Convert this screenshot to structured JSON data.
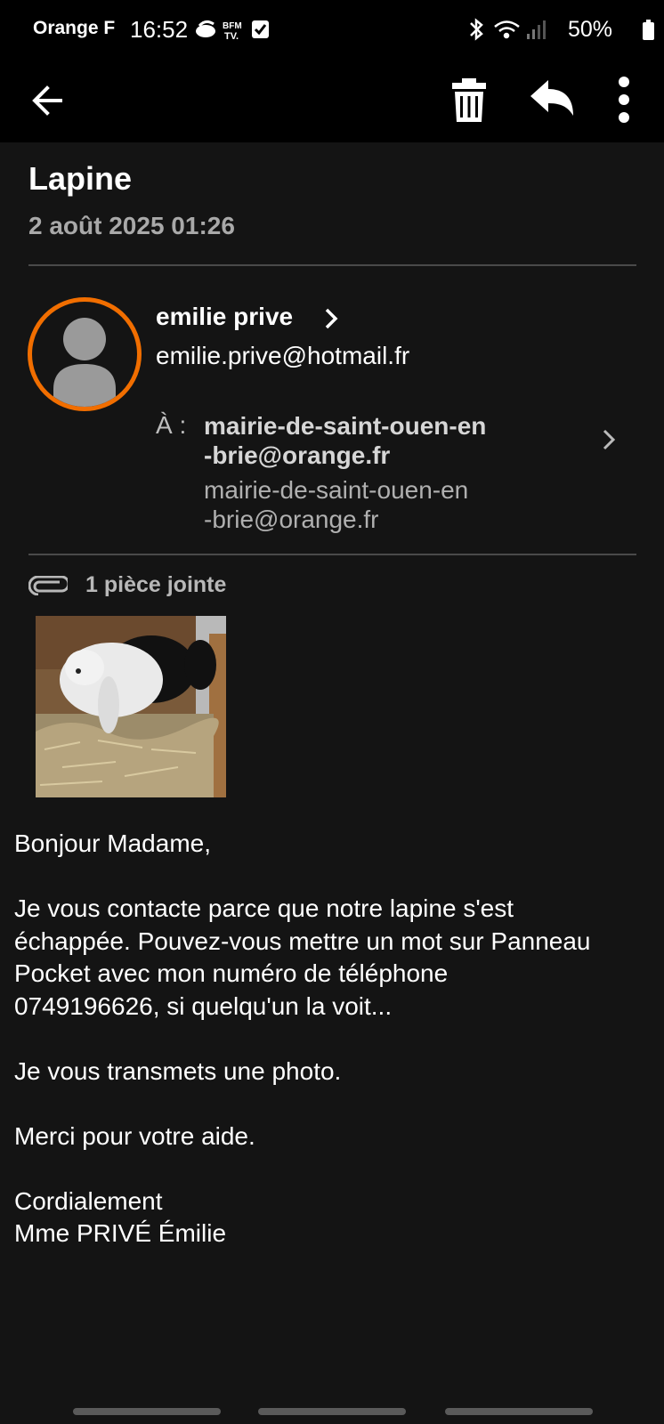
{
  "status_bar": {
    "carrier": "Orange F",
    "time": "16:52",
    "battery": "50%",
    "left_icons": [
      "weather-icon",
      "bfm-tv-icon",
      "checkbox-icon"
    ],
    "right_icons": [
      "bluetooth-icon",
      "wifi-icon",
      "signal-icon",
      "battery-icon"
    ]
  },
  "toolbar": {
    "back_icon": "arrow-left-icon",
    "delete_icon": "trash-icon",
    "reply_icon": "reply-icon",
    "more_icon": "more-vertical-icon"
  },
  "email": {
    "subject": "Lapine",
    "date": "2 août 2025 01:26",
    "sender": {
      "name": "emilie prive",
      "email": "emilie.prive@hotmail.fr"
    },
    "recipient": {
      "label": "À :",
      "name_line1": "mairie-de-saint-ouen-en",
      "name_line2": "-brie@orange.fr",
      "email_line1": "mairie-de-saint-ouen-en",
      "email_line2": "-brie@orange.fr"
    },
    "attachments": {
      "label": "1 pièce jointe"
    },
    "body": {
      "greeting": "Bonjour Madame,",
      "para1_line1": "Je vous contacte parce que notre lapine s'est",
      "para1_line2": "échappée. Pouvez-vous mettre un mot sur Panneau",
      "para1_line3": "Pocket avec mon numéro de téléphone",
      "para1_line4": "0749196626, si quelqu'un la voit...",
      "para2": "Je vous transmets une photo.",
      "para3": "Merci pour votre aide.",
      "closing": "Cordialement",
      "signature": "Mme PRIVÉ Émilie"
    }
  },
  "colors": {
    "accent": "#f16e00",
    "background": "#141414",
    "bar": "#000000"
  }
}
